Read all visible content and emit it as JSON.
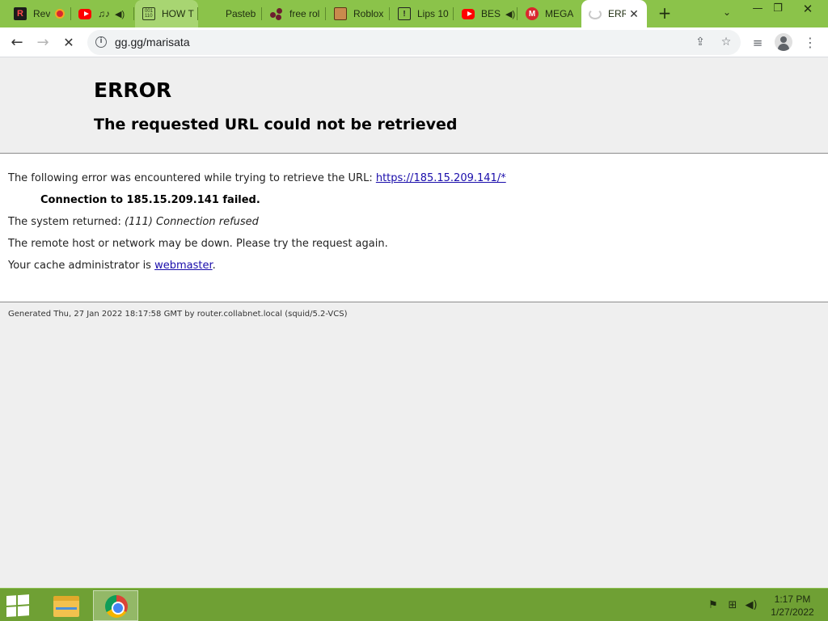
{
  "browser": {
    "tabs": [
      {
        "title": "Rev",
        "favicon": "reddit-r-icon"
      },
      {
        "title": "♫♪",
        "favicon": "youtube-icon"
      },
      {
        "title": "HOW T",
        "favicon": "document-icon"
      },
      {
        "title": "Pasteb",
        "favicon": "blank-icon"
      },
      {
        "title": "free rol",
        "favicon": "dots-icon"
      },
      {
        "title": "Roblox",
        "favicon": "character-icon"
      },
      {
        "title": "Lips 10",
        "favicon": "phone-icon"
      },
      {
        "title": "BES",
        "favicon": "youtube-icon"
      },
      {
        "title": "MEGA",
        "favicon": "mega-icon"
      },
      {
        "title": "ERR",
        "favicon": "loading-spinner-icon"
      }
    ],
    "new_tab_label": "+",
    "address": "gg.gg/marisata"
  },
  "page": {
    "title": "ERROR",
    "subtitle": "The requested URL could not be retrieved",
    "intro": "The following error was encountered while trying to retrieve the URL: ",
    "url_link": "https://185.15.209.141/*",
    "failure": "Connection to 185.15.209.141 failed.",
    "system_returned_label": "The system returned: ",
    "system_returned_value": "(111) Connection refused",
    "remote_note": "The remote host or network may be down. Please try the request again.",
    "cache_admin_label": "Your cache administrator is ",
    "cache_admin_link": "webmaster",
    "cache_admin_suffix": ".",
    "footer": "Generated Thu, 27 Jan 2022 18:17:58 GMT by router.collabnet.local (squid/5.2-VCS)"
  },
  "taskbar": {
    "time": "1:17 PM",
    "date": "1/27/2022"
  }
}
